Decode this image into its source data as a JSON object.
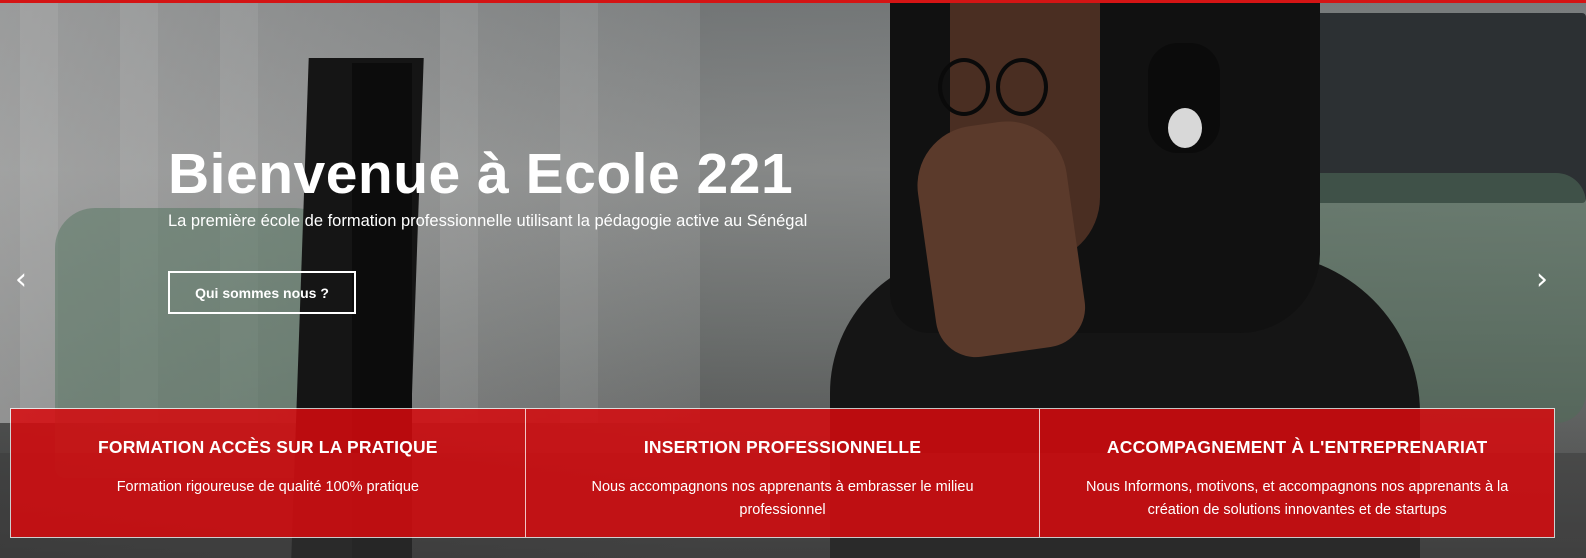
{
  "hero": {
    "title": "Bienvenue à Ecole 221",
    "subtitle": "La première école de formation professionnelle utilisant la pédagogie active au Sénégal",
    "cta_label": "Qui sommes nous ?",
    "prev_arrow": "‹",
    "next_arrow": "›"
  },
  "features": [
    {
      "title": "FORMATION ACCÈS SUR LA PRATIQUE",
      "text": "Formation rigoureuse de qualité 100% pratique"
    },
    {
      "title": "INSERTION PROFESSIONNELLE",
      "text": "Nous accompagnons nos apprenants à embrasser le milieu professionnel"
    },
    {
      "title": "ACCOMPAGNEMENT À L'ENTREPRENARIAT",
      "text": "Nous Informons, motivons, et accompagnons nos apprenants à la création de solutions innovantes et de startups"
    }
  ],
  "colors": {
    "accent": "#d41414",
    "feature_background": "#d60a0e"
  },
  "icons": {
    "prev": "chevron-left-icon",
    "next": "chevron-right-icon"
  }
}
